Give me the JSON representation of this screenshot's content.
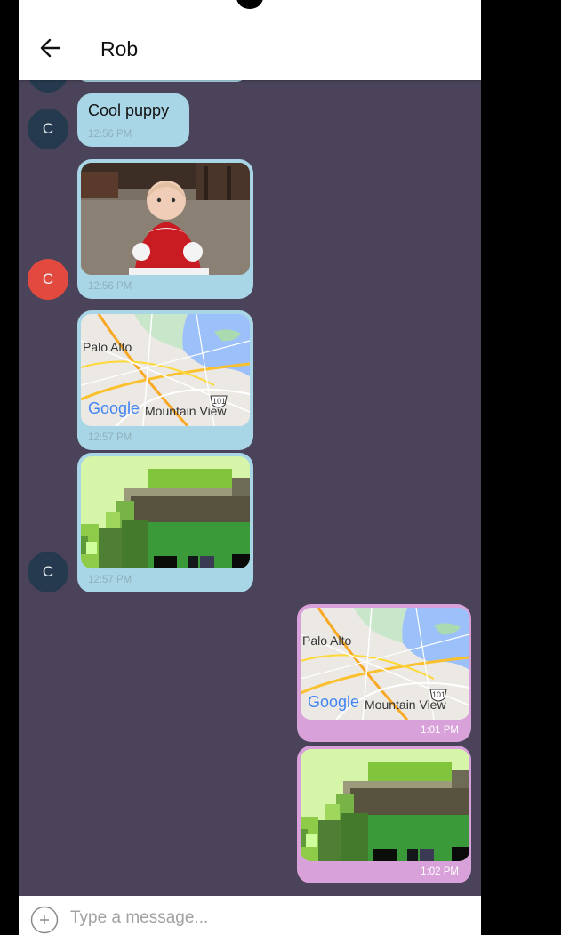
{
  "header": {
    "title": "Rob"
  },
  "contact_avatar": {
    "initial": "C"
  },
  "messages": [
    {
      "direction": "incoming",
      "type": "text",
      "text": "Cool puppy",
      "time": "12:56 PM"
    },
    {
      "direction": "incoming",
      "type": "image",
      "subject": "baby in red dress",
      "time": "12:56 PM"
    },
    {
      "direction": "incoming",
      "type": "map",
      "map_labels": [
        "Palo Alto",
        "Mountain View",
        "101"
      ],
      "map_brand": "Google",
      "time": "12:57 PM"
    },
    {
      "direction": "incoming",
      "type": "image",
      "subject": "pixelated green image",
      "time": "12:57 PM"
    },
    {
      "direction": "outgoing",
      "type": "map",
      "map_labels": [
        "Palo Alto",
        "Mountain View",
        "101"
      ],
      "map_brand": "Google",
      "time": "1:01 PM"
    },
    {
      "direction": "outgoing",
      "type": "image",
      "subject": "pixelated green image",
      "time": "1:02 PM"
    }
  ],
  "composer": {
    "placeholder": "Type a message..."
  },
  "icons": [
    "back-arrow-icon",
    "add-attachment-icon"
  ],
  "colors": {
    "chat_background": "#4a4359",
    "incoming_bubble": "#a9d6e6",
    "outgoing_bubble": "#d9a1d9",
    "avatar_dark": "#263a4f",
    "avatar_red": "#e24a3f"
  }
}
